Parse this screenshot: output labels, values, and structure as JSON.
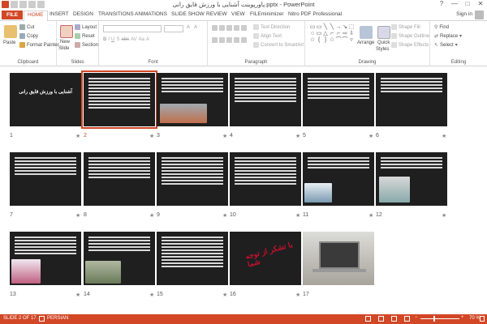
{
  "window": {
    "title": "پاورپوینت آشنایی با ورزش قایق رانی.pptx - PowerPoint",
    "controls": [
      "?",
      "—",
      "□",
      "✕"
    ]
  },
  "tabs": [
    "FILE",
    "HOME",
    "INSERT",
    "DESIGN",
    "TRANSITIONS",
    "ANIMATIONS",
    "SLIDE SHOW",
    "REVIEW",
    "VIEW",
    "FILEminimizer",
    "Nitro PDF Professional"
  ],
  "account": {
    "signin": "Sign in"
  },
  "ribbon": {
    "clipboard": {
      "paste": "Paste",
      "cut": "Cut",
      "copy": "Copy",
      "format_painter": "Format Painter",
      "label": "Clipboard"
    },
    "slides": {
      "new_slide": "New",
      "new_slide2": "Slide",
      "layout": "Layout",
      "reset": "Reset",
      "section": "Section",
      "label": "Slides"
    },
    "font": {
      "label": "Font"
    },
    "paragraph": {
      "text_direction": "Text Direction",
      "align_text": "Align Text",
      "convert_smartart": "Convert to SmartArt",
      "label": "Paragraph"
    },
    "drawing": {
      "arrange": "Arrange",
      "quick_styles": "Quick",
      "quick_styles2": "Styles",
      "shape_fill": "Shape Fill",
      "shape_outline": "Shape Outline",
      "shape_effects": "Shape Effects",
      "label": "Drawing"
    },
    "editing": {
      "find": "Find",
      "replace": "Replace",
      "select": "Select",
      "label": "Editing"
    }
  },
  "slides": [
    {
      "num": "1",
      "title": "آشنایی با ورزش قایق رانی"
    },
    {
      "num": "2"
    },
    {
      "num": "3"
    },
    {
      "num": "4"
    },
    {
      "num": "5"
    },
    {
      "num": "6"
    },
    {
      "num": "7"
    },
    {
      "num": "8"
    },
    {
      "num": "9"
    },
    {
      "num": "10"
    },
    {
      "num": "11"
    },
    {
      "num": "12"
    },
    {
      "num": "13"
    },
    {
      "num": "14"
    },
    {
      "num": "15"
    },
    {
      "num": "16",
      "title": "با تشکر از توجه شما"
    },
    {
      "num": "17"
    }
  ],
  "status": {
    "slide_info": "SLIDE 2 OF 17",
    "language": "PERSIAN",
    "zoom": "70 %",
    "zoom_percent": 70
  },
  "colors": {
    "accent": "#d24726"
  }
}
